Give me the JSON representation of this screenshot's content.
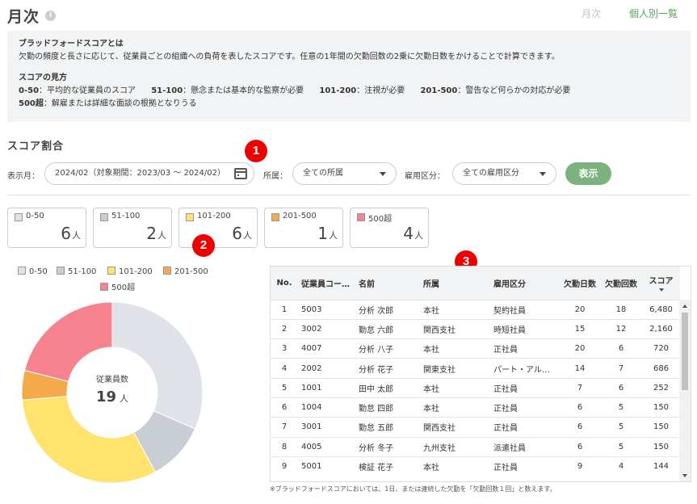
{
  "header": {
    "title": "月次",
    "links": {
      "monthly": "月次",
      "individual": "個人別一覧"
    }
  },
  "description": {
    "heading1": "ブラッドフォードスコアとは",
    "text1": "欠勤の頻度と長さに応じて、従業員ごとの組織への負荷を表したスコアです。任意の1年間の欠勤回数の2乗に欠勤日数をかけることで計算できます。",
    "heading2": "スコアの見方",
    "ranges": [
      {
        "range": "0-50",
        "text": "：平均的な従業員のスコア"
      },
      {
        "range": "51-100",
        "text": "：懸念または基本的な監察が必要"
      },
      {
        "range": "101-200",
        "text": "：注視が必要"
      },
      {
        "range": "201-500",
        "text": "：警告など何らかの対応が必要"
      }
    ],
    "range_over": {
      "range": "500超",
      "text": "：解雇または詳細な面談の根拠となりうる"
    }
  },
  "section": {
    "title": "スコア割合"
  },
  "filters": {
    "month_label": "表示月：",
    "month_value": "2024/02（対象期間：2023/03 ～ 2024/02）",
    "dept_label": "所属：",
    "dept_value": "全ての所属",
    "employment_label": "雇用区分：",
    "employment_value": "全ての雇用区分",
    "show_button": "表示"
  },
  "annotations": {
    "one": "1",
    "two": "2",
    "three": "3"
  },
  "colors": {
    "0-50": "#dfe2e6",
    "51-100": "#c9ced4",
    "101-200": "#ffe36e",
    "201-500": "#f4a94b",
    "500超": "#f7828f",
    "accent": "#7cb27e"
  },
  "score_cards": [
    {
      "label": "0-50",
      "count": "6",
      "unit": "人",
      "color": "#dfe2e6"
    },
    {
      "label": "51-100",
      "count": "2",
      "unit": "人",
      "color": "#c9ced4"
    },
    {
      "label": "101-200",
      "count": "6",
      "unit": "人",
      "color": "#ffe36e"
    },
    {
      "label": "201-500",
      "count": "1",
      "unit": "人",
      "color": "#f4a94b"
    },
    {
      "label": "500超",
      "count": "4",
      "unit": "人",
      "color": "#f7828f"
    }
  ],
  "chart_data": {
    "type": "pie",
    "categories": [
      "0-50",
      "51-100",
      "101-200",
      "201-500",
      "500超"
    ],
    "values": [
      6,
      2,
      6,
      1,
      4
    ],
    "colors": [
      "#dfe2e6",
      "#c9ced4",
      "#ffe36e",
      "#f4a94b",
      "#f7828f"
    ],
    "center_label": "従業員数",
    "center_value": "19",
    "center_unit": "人",
    "legend_position": "top"
  },
  "table": {
    "headers": [
      "No.",
      "従業員コー…",
      "名前",
      "所属",
      "雇用区分",
      "欠勤日数",
      "欠勤回数",
      "スコア"
    ],
    "rows": [
      [
        "1",
        "5003",
        "分析 次郎",
        "本社",
        "契約社員",
        "20",
        "18",
        "6,480"
      ],
      [
        "2",
        "3002",
        "勤怠 六郎",
        "関西支社",
        "時短社員",
        "15",
        "12",
        "2,160"
      ],
      [
        "3",
        "4007",
        "分析 八子",
        "本社",
        "正社員",
        "20",
        "6",
        "720"
      ],
      [
        "4",
        "2002",
        "分析 花子",
        "関東支社",
        "パート・アル…",
        "14",
        "7",
        "686"
      ],
      [
        "5",
        "1001",
        "田中 太郎",
        "本社",
        "正社員",
        "7",
        "6",
        "252"
      ],
      [
        "6",
        "1004",
        "勤怠 四郎",
        "本社",
        "正社員",
        "6",
        "5",
        "150"
      ],
      [
        "7",
        "3001",
        "勤怠 五郎",
        "関西支社",
        "正社員",
        "6",
        "5",
        "150"
      ],
      [
        "8",
        "4005",
        "分析 冬子",
        "九州支社",
        "派遣社員",
        "6",
        "5",
        "150"
      ],
      [
        "9",
        "5001",
        "検証 花子",
        "本社",
        "正社員",
        "9",
        "4",
        "144"
      ]
    ]
  },
  "footnote": "※ブラッドフォードスコアにおいては、1日、または連続した欠勤を「欠勤回数１回」と数えます。"
}
